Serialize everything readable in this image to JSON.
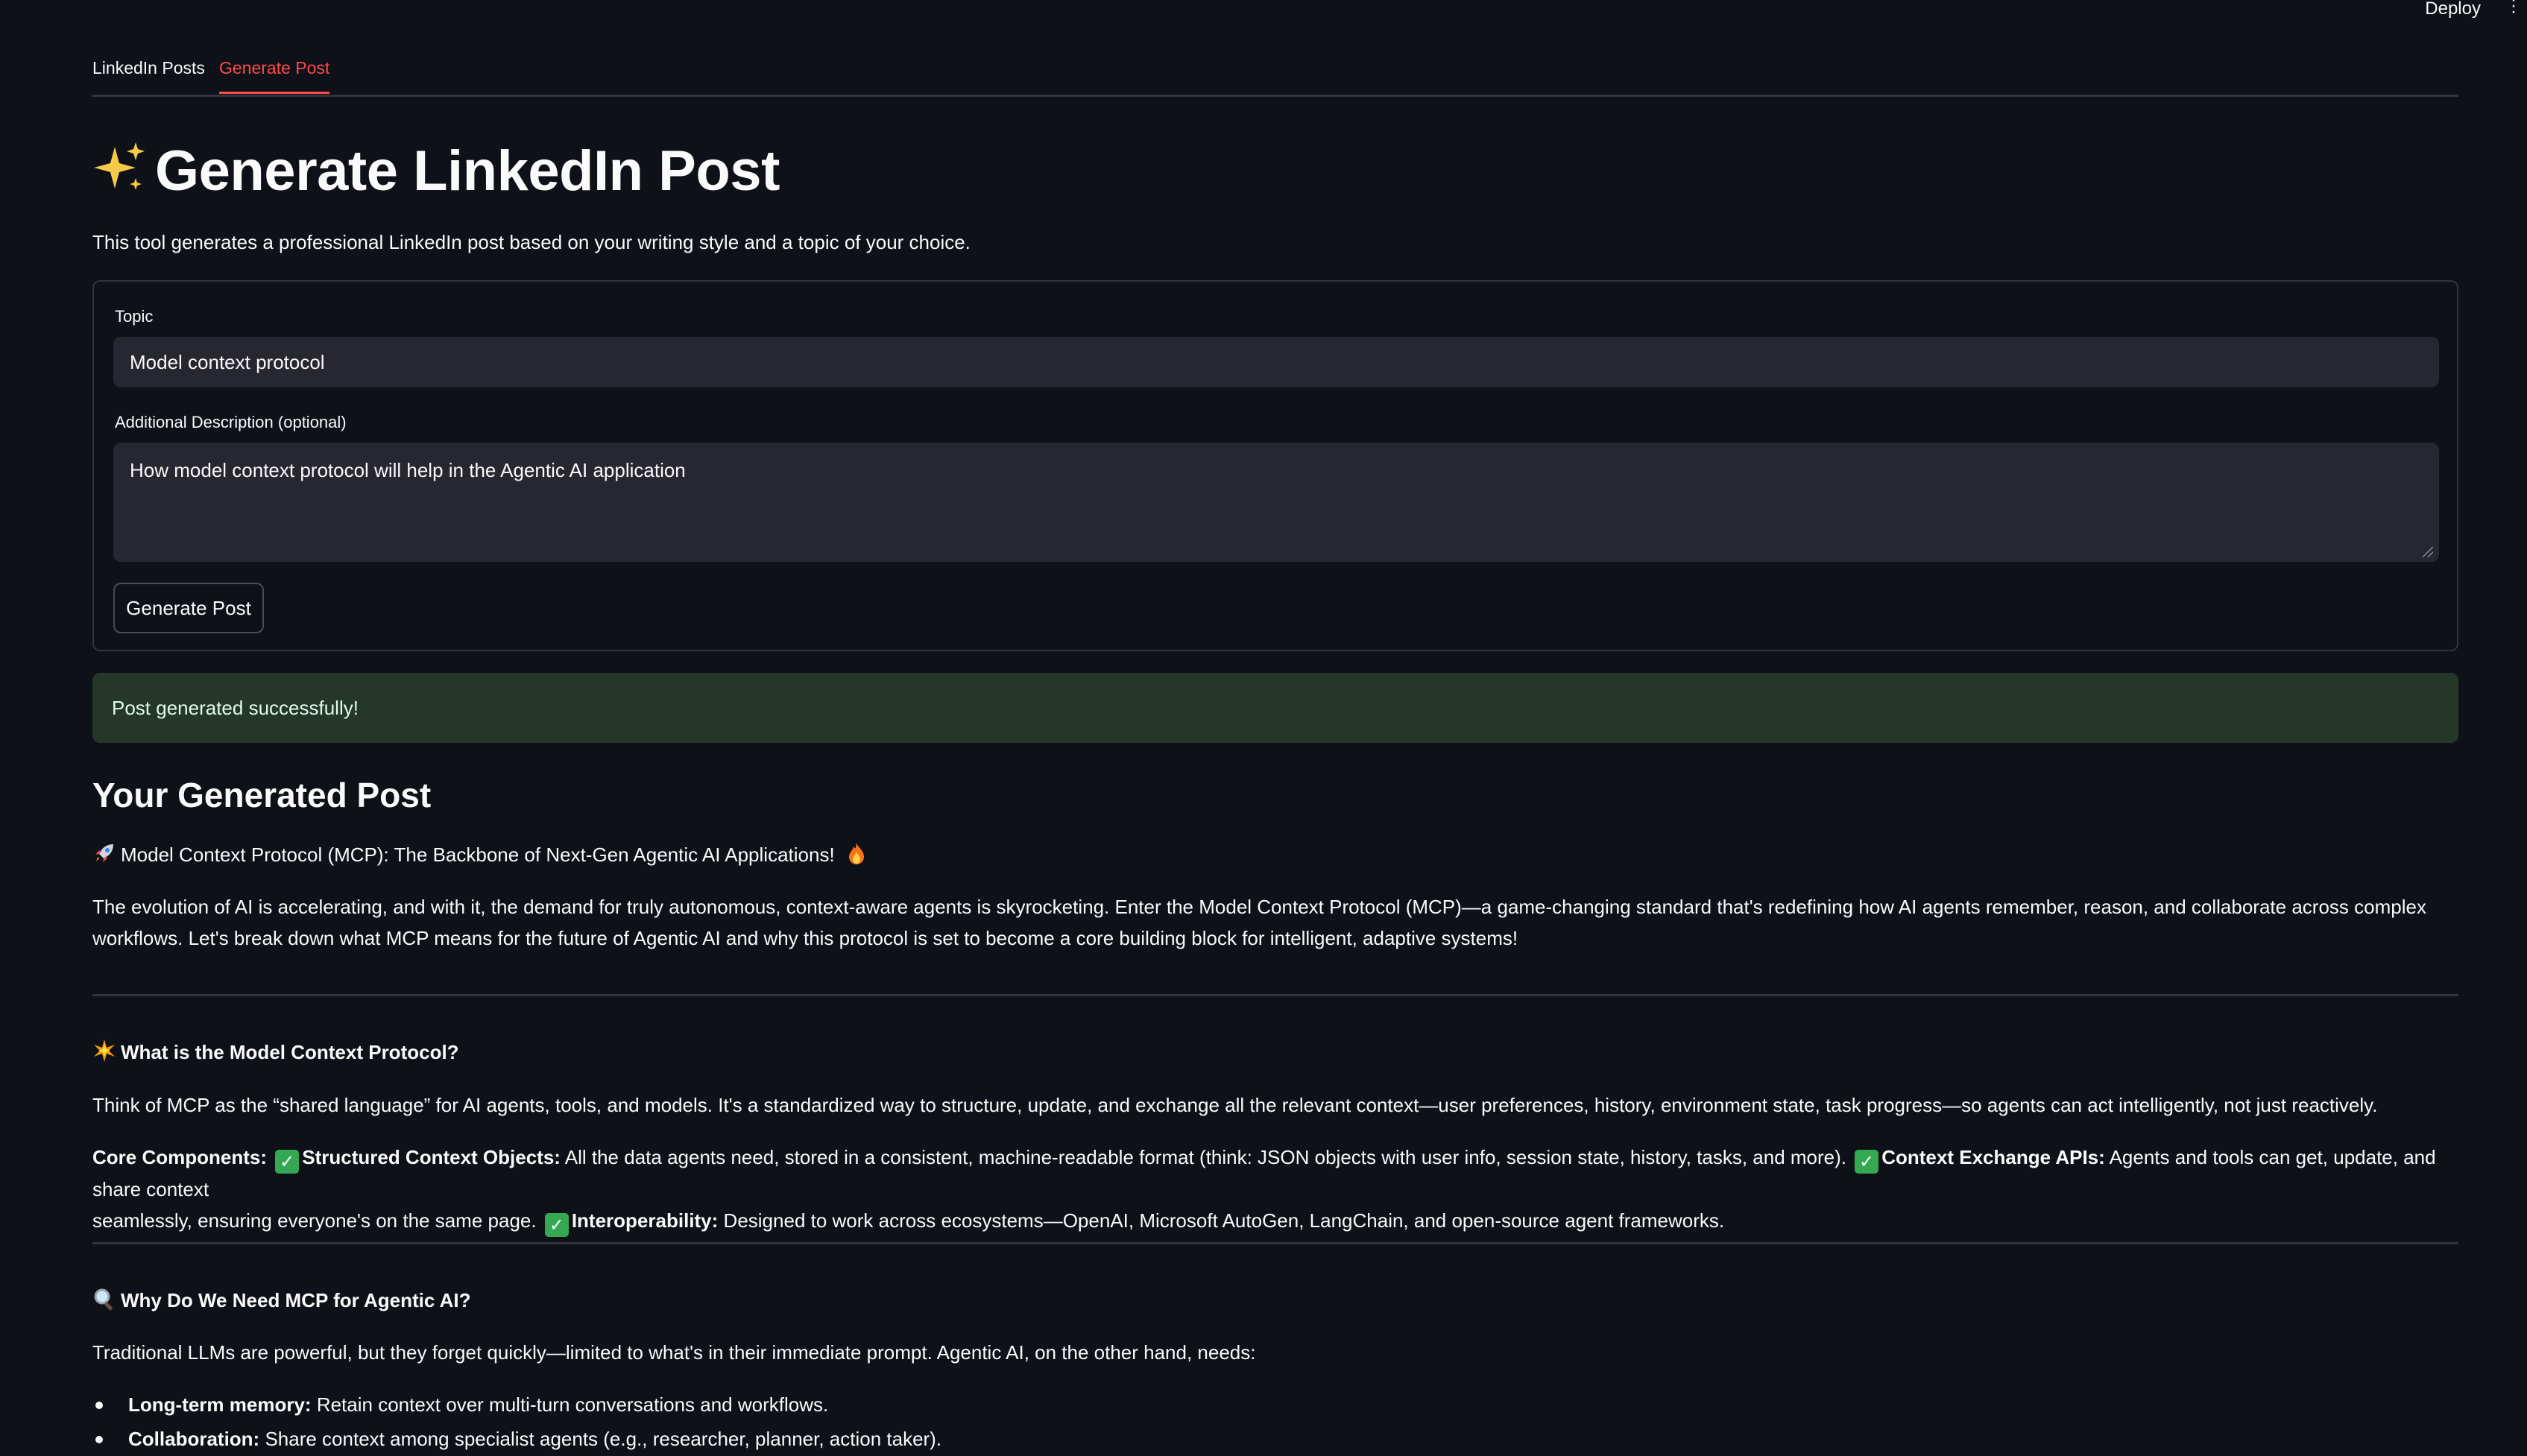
{
  "header": {
    "deploy_label": "Deploy"
  },
  "tabs": [
    {
      "label": "LinkedIn Posts",
      "active": false
    },
    {
      "label": "Generate Post",
      "active": true
    }
  ],
  "page": {
    "title": "Generate LinkedIn Post",
    "title_icon": "sparkles-icon",
    "subtitle": "This tool generates a professional LinkedIn post based on your writing style and a topic of your choice."
  },
  "form": {
    "topic_label": "Topic",
    "topic_value": "Model context protocol",
    "description_label": "Additional Description (optional)",
    "description_value": "How model context protocol will help in the Agentic AI application",
    "button_label": "Generate Post"
  },
  "alert": {
    "text": "Post generated successfully!",
    "color": "#253728"
  },
  "post": {
    "heading": "Your Generated Post",
    "title": "Model Context Protocol (MCP): The Backbone of Next-Gen Agentic AI Applications!",
    "intro_line1": "The evolution of AI is accelerating, and with it, the demand for truly autonomous, context-aware agents is skyrocketing. Enter the Model Context Protocol (MCP)—a game-changing standard that's redefining how AI agents remember, reason, and collaborate across complex",
    "intro_line2": "workflows. Let's break down what MCP means for the future of Agentic AI and why this protocol is set to become a core building block for intelligent, adaptive systems!",
    "section1_title": "What is the Model Context Protocol?",
    "section1_body": "Think of MCP as the “shared language” for AI agents, tools, and models. It's a standardized way to structure, update, and exchange all the relevant context—user preferences, history, environment state, task progress—so agents can act intelligently, not just reactively.",
    "core_label": "Core Components:",
    "comp1_label": "Structured Context Objects:",
    "comp1_text": "All the data agents need, stored in a consistent, machine-readable format (think: JSON objects with user info, session state, history, tasks, and more).",
    "comp2_label": "Context Exchange APIs:",
    "comp2_text_line1": "Agents and tools can get, update, and share context",
    "comp2_text_line2": "seamlessly, ensuring everyone's on the same page.",
    "comp3_label": "Interoperability:",
    "comp3_text": "Designed to work across ecosystems—OpenAI, Microsoft AutoGen, LangChain, and open-source agent frameworks.",
    "section2_title": "Why Do We Need MCP for Agentic AI?",
    "section2_body": "Traditional LLMs are powerful, but they forget quickly—limited to what's in their immediate prompt. Agentic AI, on the other hand, needs:",
    "bullets": [
      {
        "label": "Long-term memory:",
        "text": "Retain context over multi-turn conversations and workflows."
      },
      {
        "label": "Collaboration:",
        "text": "Share context among specialist agents (e.g., researcher, planner, action taker)."
      }
    ]
  }
}
